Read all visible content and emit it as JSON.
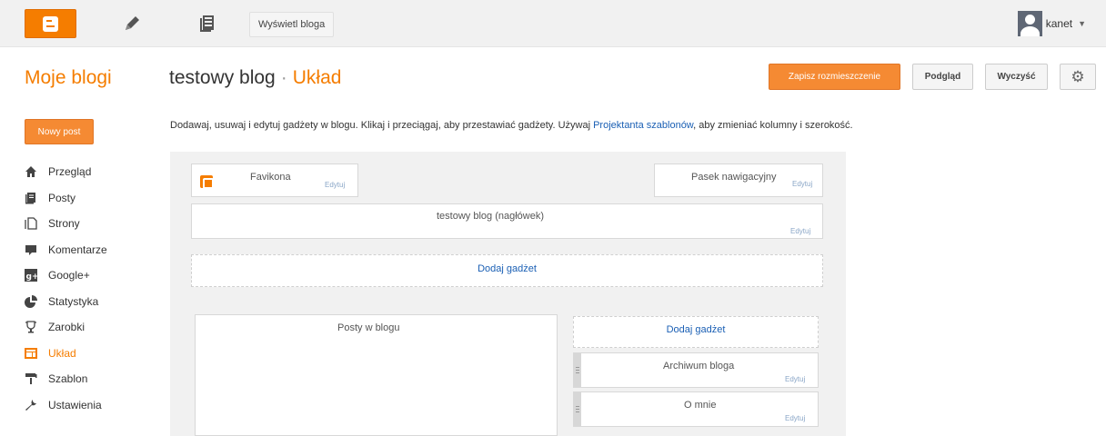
{
  "topbar": {
    "view_blog_label": "Wyświetl bloga",
    "username": "kanet"
  },
  "header": {
    "my_blogs": "Moje blogi",
    "blog_name": "testowy blog",
    "separator": "·",
    "section": "Układ"
  },
  "actions": {
    "save": "Zapisz rozmieszczenie",
    "preview": "Podgląd",
    "clear": "Wyczyść",
    "settings_icon": "gear-icon"
  },
  "sidebar": {
    "new_post": "Nowy post",
    "items": [
      {
        "label": "Przegląd",
        "icon": "home-icon"
      },
      {
        "label": "Posty",
        "icon": "posts-icon"
      },
      {
        "label": "Strony",
        "icon": "pages-icon"
      },
      {
        "label": "Komentarze",
        "icon": "comments-icon"
      },
      {
        "label": "Google+",
        "icon": "google-plus-icon"
      },
      {
        "label": "Statystyka",
        "icon": "stats-icon"
      },
      {
        "label": "Zarobki",
        "icon": "trophy-icon"
      },
      {
        "label": "Układ",
        "icon": "layout-icon",
        "active": true
      },
      {
        "label": "Szablon",
        "icon": "template-icon"
      },
      {
        "label": "Ustawienia",
        "icon": "wrench-icon"
      }
    ]
  },
  "intro": {
    "text_before": "Dodawaj, usuwaj i edytuj gadżety w blogu. Klikaj i przeciągaj, aby przestawiać gadżety. Używaj ",
    "link": "Projektanta szablonów",
    "text_after": ", aby zmieniać kolumny i szerokość."
  },
  "layout": {
    "edit_label": "Edytuj",
    "favicon": "Favikona",
    "navbar": "Pasek nawigacyjny",
    "header": "testowy blog (nagłówek)",
    "add_gadget": "Dodaj gadżet",
    "posts": "Posty w blogu",
    "sidebar_add_gadget": "Dodaj gadżet",
    "archive": "Archiwum bloga",
    "about": "O mnie"
  },
  "colors": {
    "accent": "#f57d00",
    "link": "#1a5fb4"
  }
}
